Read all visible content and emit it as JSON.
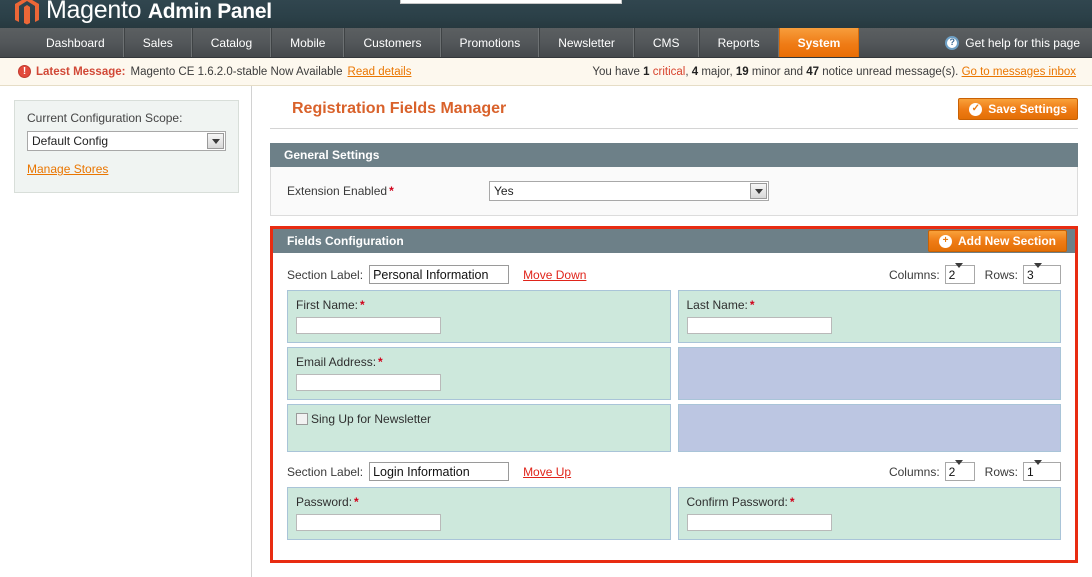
{
  "header": {
    "brand": "Magento",
    "brand_suffix": "Admin Panel",
    "logo_icon": "magento-logo-icon",
    "search_placeholder": ""
  },
  "nav": {
    "items": [
      {
        "label": "Dashboard",
        "active": false
      },
      {
        "label": "Sales",
        "active": false
      },
      {
        "label": "Catalog",
        "active": false
      },
      {
        "label": "Mobile",
        "active": false
      },
      {
        "label": "Customers",
        "active": false
      },
      {
        "label": "Promotions",
        "active": false
      },
      {
        "label": "Newsletter",
        "active": false
      },
      {
        "label": "CMS",
        "active": false
      },
      {
        "label": "Reports",
        "active": false
      },
      {
        "label": "System",
        "active": true
      }
    ],
    "help_label": "Get help for this page",
    "help_icon": "question-mark-icon"
  },
  "message_bar": {
    "warn_icon": "exclamation-icon",
    "latest_label": "Latest Message:",
    "latest_text": "Magento CE 1.6.2.0-stable Now Available",
    "read_details_link": "Read details",
    "unread_prefix": "You have",
    "critical_count": "1",
    "critical_word": "critical",
    "major_count": "4",
    "major_word": "major,",
    "minor_count": "19",
    "minor_word": "minor and",
    "notice_count": "47",
    "notice_word": "notice unread message(s).",
    "inbox_link": "Go to messages inbox"
  },
  "sidebar": {
    "scope_label": "Current Configuration Scope:",
    "scope_value": "Default Config",
    "manage_stores_link": "Manage Stores"
  },
  "main": {
    "page_title": "Registration Fields Manager",
    "save_button": "Save Settings",
    "save_icon": "check-circle-icon",
    "general_settings": {
      "heading": "General Settings",
      "extension_enabled_label": "Extension Enabled",
      "extension_enabled_value": "Yes",
      "required_marker": "*"
    },
    "fields_configuration": {
      "heading": "Fields Configuration",
      "add_section_button": "Add New Section",
      "add_section_icon": "plus-circle-icon",
      "section_label_prefix": "Section Label:",
      "columns_label": "Columns:",
      "rows_label": "Rows:",
      "sections": [
        {
          "name": "Personal Information",
          "move_link": "Move Down",
          "columns": "2",
          "rows": "3",
          "grid": [
            [
              {
                "type": "input",
                "label": "First Name:",
                "required": "*",
                "fill": "green"
              },
              {
                "type": "input",
                "label": "Last Name:",
                "required": "*",
                "fill": "green"
              }
            ],
            [
              {
                "type": "input",
                "label": "Email Address:",
                "required": "*",
                "fill": "green"
              },
              {
                "type": "empty",
                "label": "",
                "required": "",
                "fill": "blue"
              }
            ],
            [
              {
                "type": "checkbox",
                "label": "Sing Up for Newsletter",
                "required": "",
                "fill": "green"
              },
              {
                "type": "empty",
                "label": "",
                "required": "",
                "fill": "blue"
              }
            ]
          ]
        },
        {
          "name": "Login Information",
          "move_link": "Move Up",
          "columns": "2",
          "rows": "1",
          "grid": [
            [
              {
                "type": "input",
                "label": "Password:",
                "required": "*",
                "fill": "green"
              },
              {
                "type": "input",
                "label": "Confirm Password:",
                "required": "*",
                "fill": "green"
              }
            ]
          ]
        }
      ]
    }
  },
  "colors": {
    "accent_orange": "#ef7c16",
    "panel_header": "#6d8088",
    "highlight_border": "#e82c12",
    "cell_green": "#cde8dc",
    "cell_blue": "#bcc6e2",
    "title_orange": "#d9622b"
  }
}
